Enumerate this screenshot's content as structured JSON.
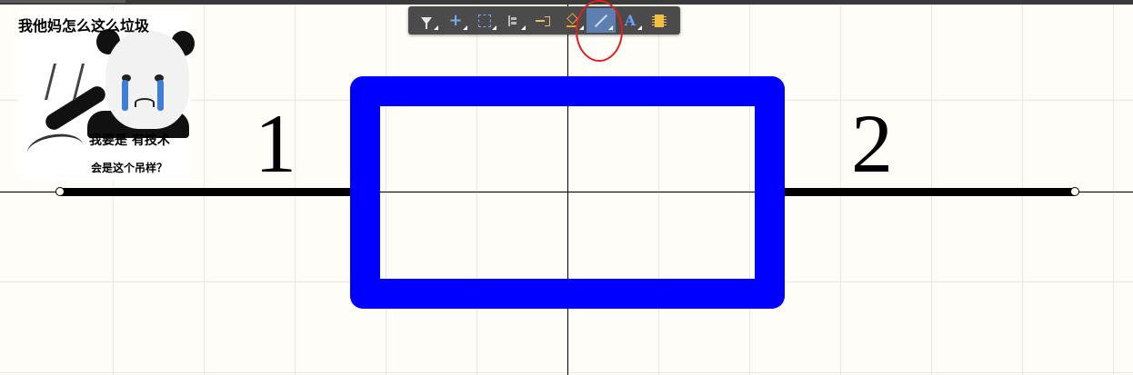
{
  "canvas": {
    "background": "#fffdf8",
    "grid_color": "#ebe8df",
    "crosshair_color": "#000000"
  },
  "schematic": {
    "component": {
      "type": "resistor",
      "body_color": "#0000ff",
      "pin_left_label": "1",
      "pin_right_label": "2",
      "wire_color": "#000000"
    }
  },
  "toolbar": {
    "background": "#4b4b4b",
    "active_color": "#5d80b0",
    "buttons": [
      {
        "name": "filter",
        "icon": "filter-icon"
      },
      {
        "name": "move-crosshair",
        "icon": "plus-icon"
      },
      {
        "name": "select-rectangle",
        "icon": "dashed-rectangle-icon"
      },
      {
        "name": "align",
        "icon": "align-left-icon"
      },
      {
        "name": "place-pin",
        "icon": "pin-icon"
      },
      {
        "name": "erase",
        "icon": "eraser-icon"
      },
      {
        "name": "place-line",
        "icon": "line-icon",
        "active": true
      },
      {
        "name": "place-text",
        "icon": "text-icon",
        "glyph": "A"
      },
      {
        "name": "place-part",
        "icon": "component-icon"
      }
    ]
  },
  "annotation": {
    "highlight_color": "#e02020",
    "target": "place-line"
  },
  "meme": {
    "top_text": "我他妈怎么这么垃圾",
    "bottom_line1": "我要是 有技术",
    "bottom_line2": "会是这个吊样？"
  }
}
